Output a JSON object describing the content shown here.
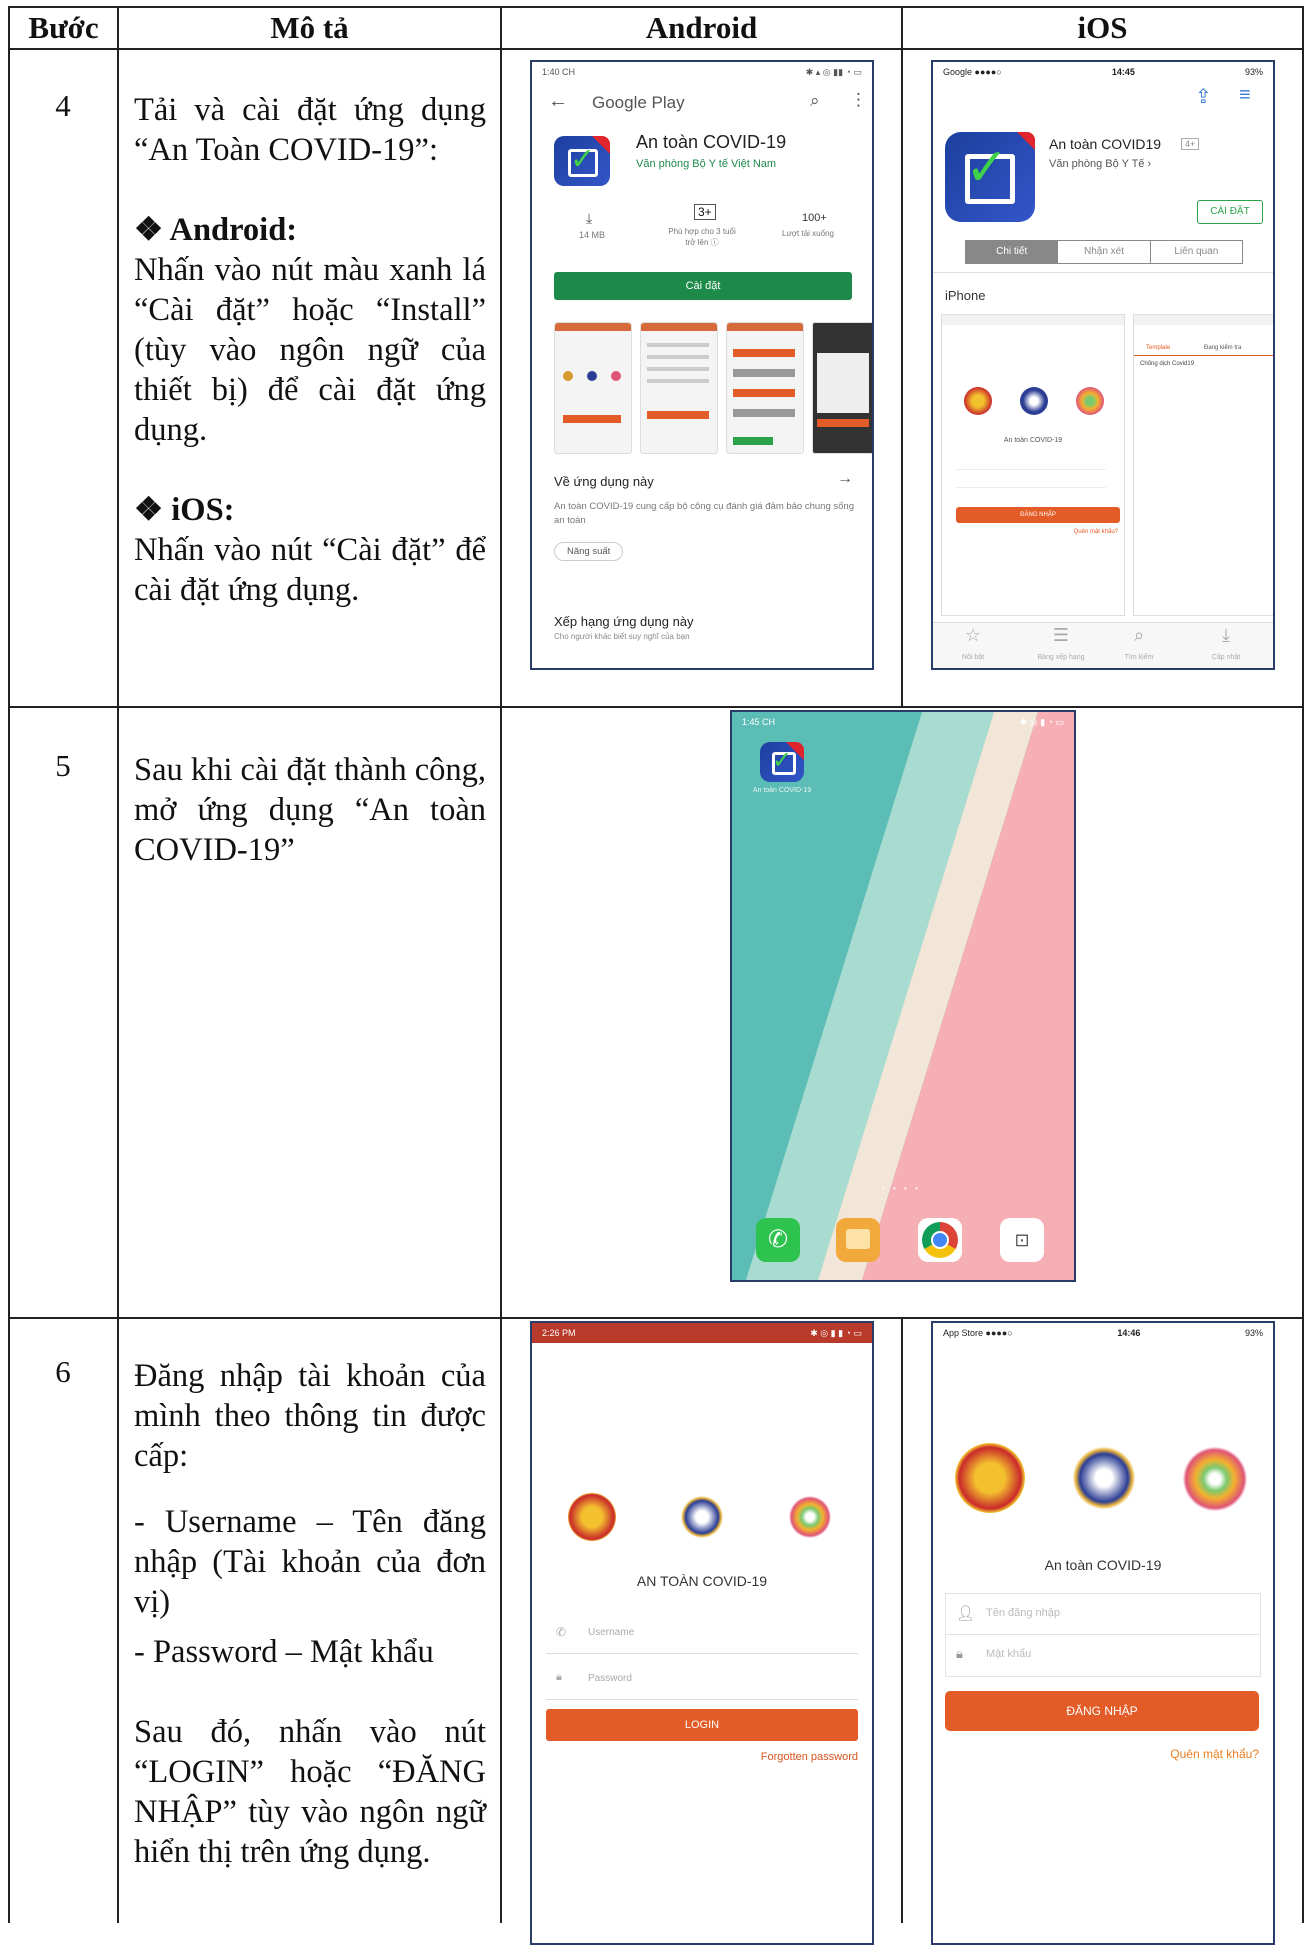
{
  "table": {
    "headers": [
      "Bước",
      "Mô tả",
      "Android",
      "iOS"
    ]
  },
  "steps": [
    {
      "number": "4",
      "title_line": "Tải và cài đặt ứng dụng “An Toàn COVID-19”:",
      "android_heading": "❖ Android:",
      "android_text": "Nhấn vào nút màu xanh lá “Cài đặt” hoặc “Install” (tùy vào ngôn ngữ của thiết bị) để cài đặt ứng dụng.",
      "ios_heading": "❖ iOS:",
      "ios_text": "Nhấn vào nút “Cài đặt” để cài đặt ứng dụng."
    },
    {
      "number": "5",
      "text": "Sau khi cài đặt thành công, mở ứng dụng “An toàn COVID-19”"
    },
    {
      "number": "6",
      "text1": "Đăng nhập tài khoản của mình theo thông tin được cấp:",
      "bullet1": "- Username – Tên đăng nhập (Tài khoản của đơn vị)",
      "bullet2": "- Password – Mật khẩu",
      "text2": "Sau đó, nhấn vào nút “LOGIN” hoặc “ĐĂNG NHẬP” tùy vào ngôn ngữ hiển thị trên ứng dụng."
    }
  ],
  "android_play": {
    "time": "1:40 CH",
    "store_title": "Google Play",
    "app_name": "An toàn COVID-19",
    "publisher": "Văn phòng Bộ Y tế Việt Nam",
    "size": "14 MB",
    "rating_badge": "3+",
    "rating_text": "Phù hợp cho 3 tuổi trở lên ⓘ",
    "downloads": "100+",
    "downloads_label": "Lượt tải xuống",
    "install_button": "Cài đặt",
    "about_title": "Về ứng dụng này",
    "about_text": "An toàn COVID-19 cung cấp bộ công cụ đánh giá đảm bảo chung sống an toàn",
    "chip": "Năng suất",
    "rate_title": "Xếp hạng ứng dụng này",
    "rate_sub": "Cho người khác biết suy nghĩ của bạn"
  },
  "ios_store": {
    "carrier": "Google ●●●●○",
    "time": "14:45",
    "battery": "93%",
    "app_name": "An toàn COVID19",
    "age": "4+",
    "publisher": "Văn phòng Bộ Y Tế ›",
    "install_button": "CÀI ĐẶT",
    "tabs": [
      "Chi tiết",
      "Nhận xét",
      "Liên quan"
    ],
    "device_label": "iPhone",
    "preview_caption": "An toàn COVID-19",
    "preview_login": "ĐĂNG NHẬP",
    "preview_forgot": "Quên mật khẩu?",
    "preview_tabs": [
      "Template",
      "Đang kiểm tra"
    ],
    "preview_item": "Chống dịch Covid19",
    "tabbar": [
      "Nổi bật",
      "Bảng xếp hạng",
      "Tìm kiếm",
      "Cập nhật"
    ]
  },
  "android_home": {
    "time": "1:45 CH",
    "icon_label": "An toàn COVID-19"
  },
  "android_login": {
    "time": "2:26 PM",
    "app_title": "AN TOÀN COVID-19",
    "username_placeholder": "Username",
    "password_placeholder": "Password",
    "login_button": "LOGIN",
    "forgot": "Forgotten password"
  },
  "ios_login": {
    "carrier": "App Store ●●●●○",
    "time": "14:46",
    "battery": "93%",
    "app_title": "An toàn COVID-19",
    "username_placeholder": "Tên đăng nhập",
    "password_placeholder": "Mật khẩu",
    "login_button": "ĐĂNG NHẬP",
    "forgot": "Quên mật khẩu?"
  },
  "colors": {
    "play_green": "#1e8a4a",
    "orange": "#e35b26",
    "status_red": "#c0392b",
    "teal": "#5bbdb5",
    "pink": "#f6b0b5"
  }
}
